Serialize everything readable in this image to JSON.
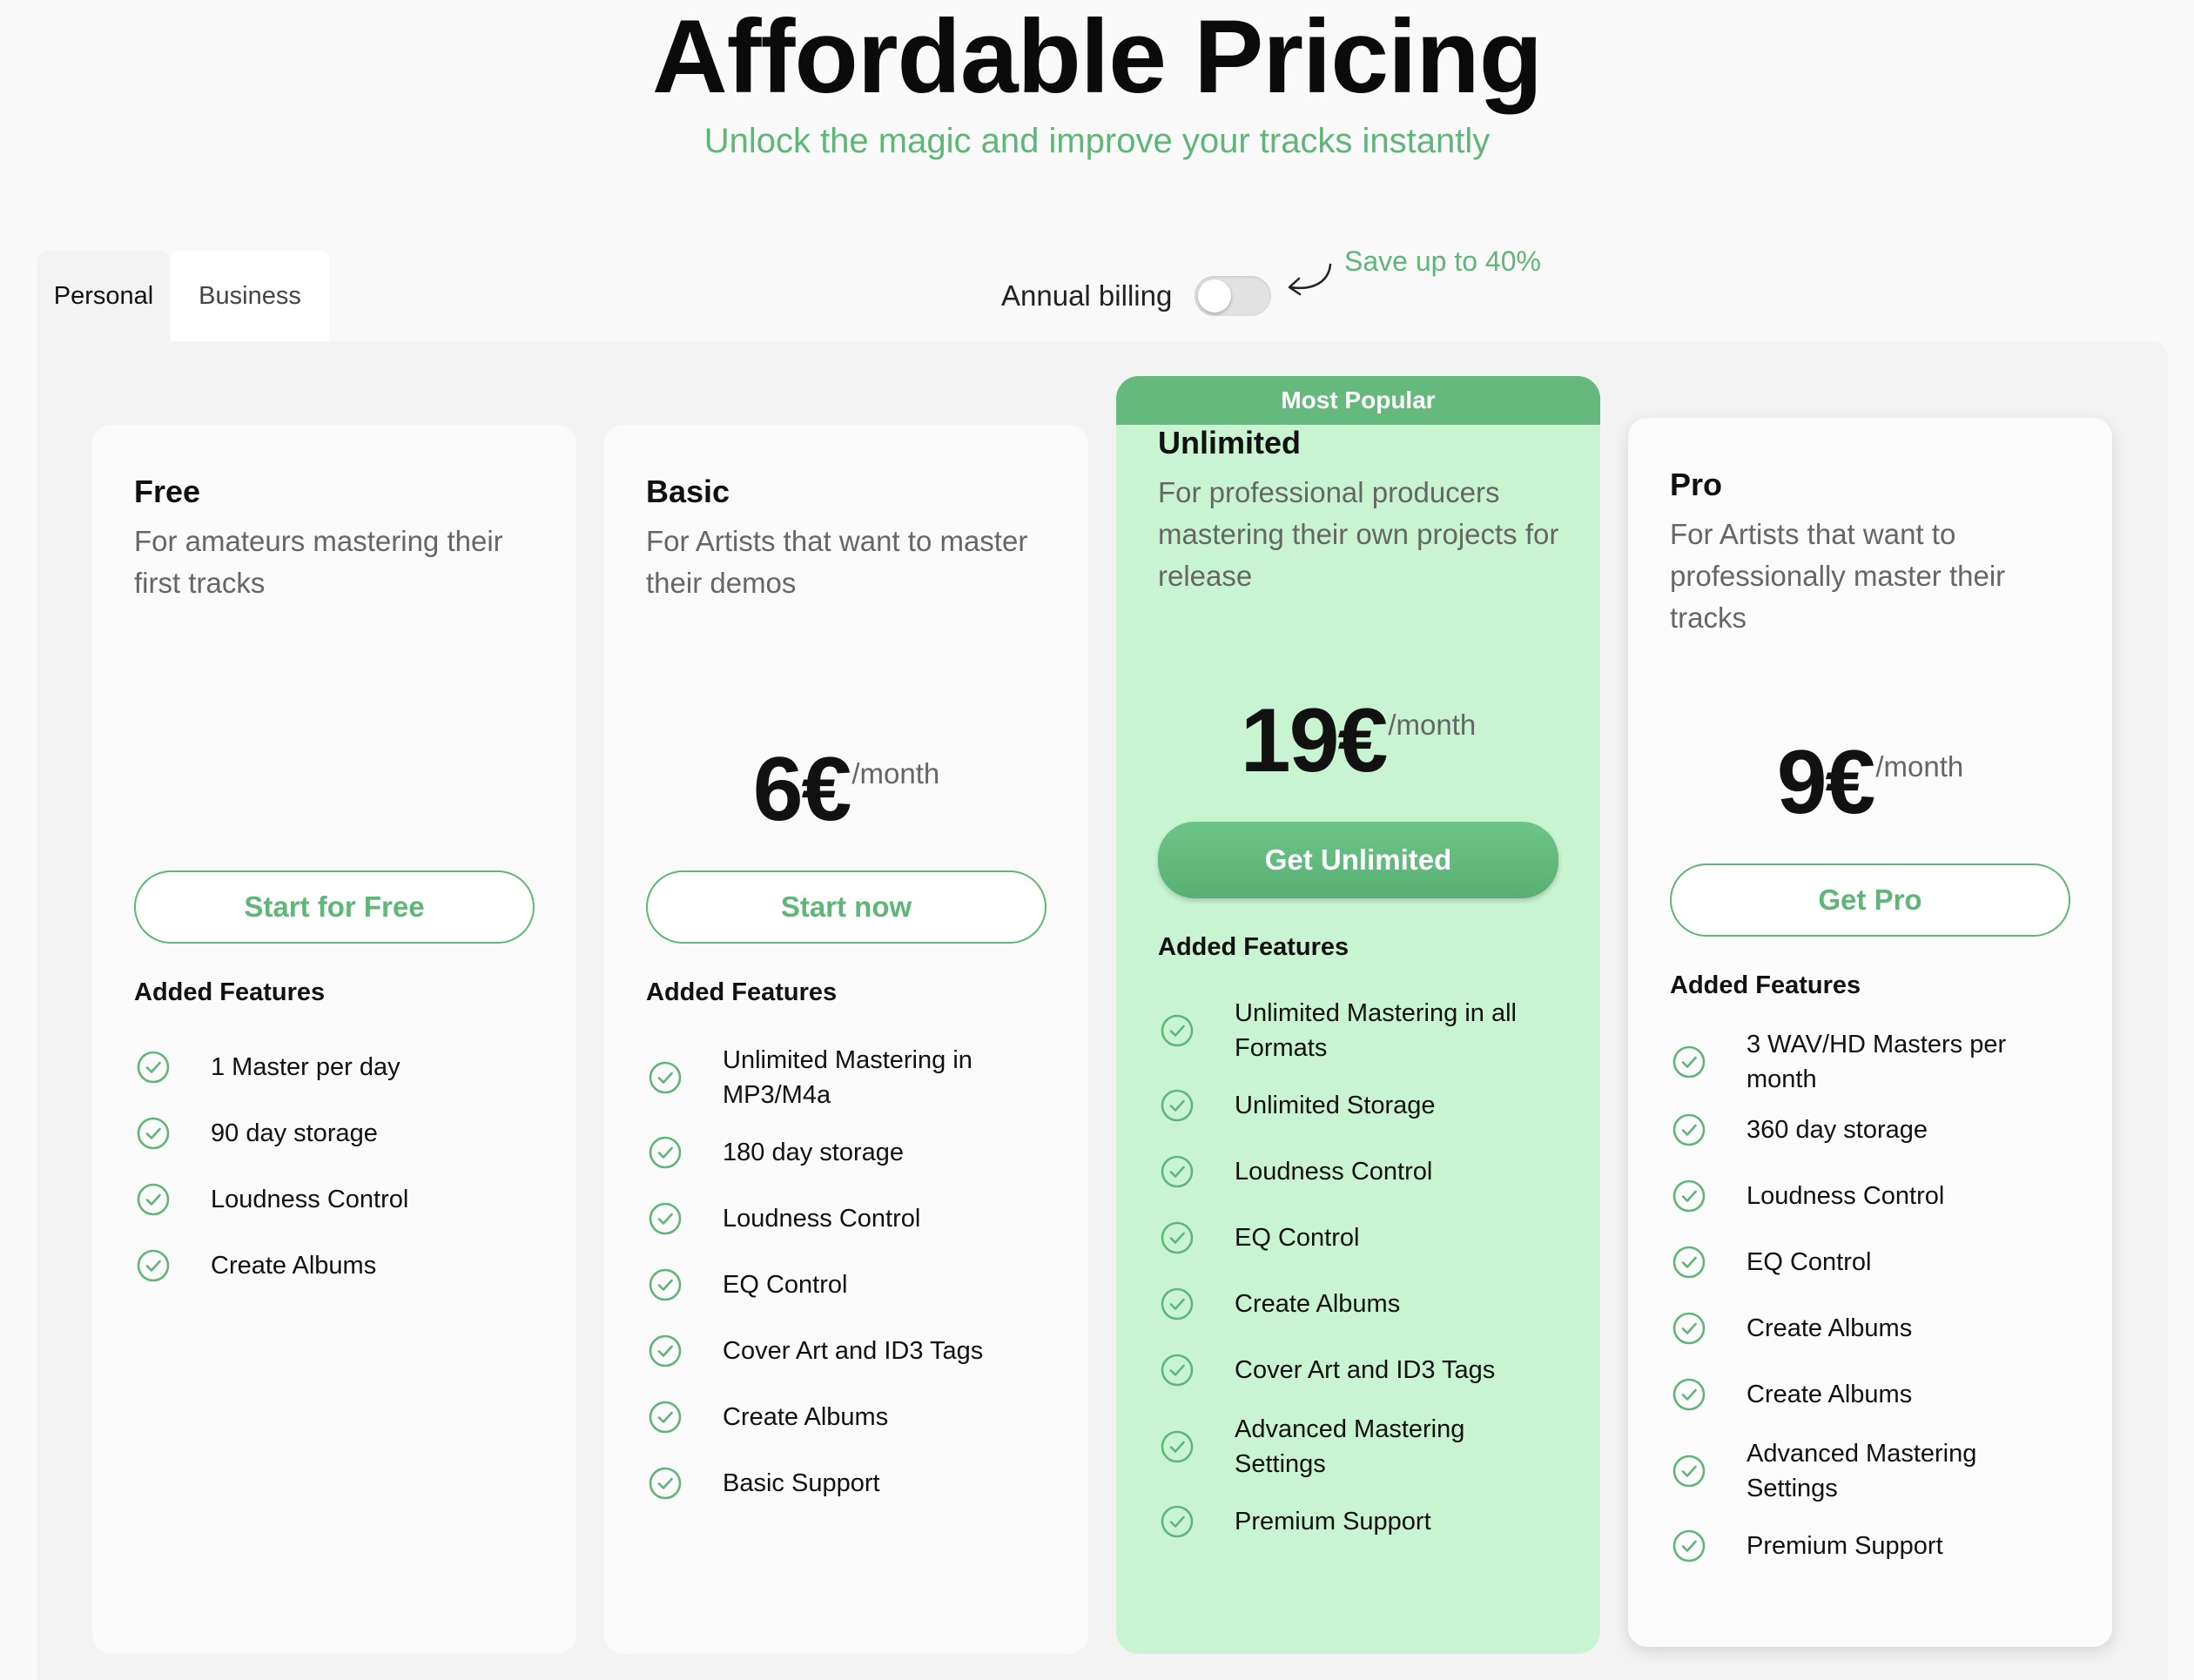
{
  "header": {
    "title": "Affordable Pricing",
    "subtitle": "Unlock the magic and improve your tracks instantly"
  },
  "tabs": [
    {
      "label": "Personal",
      "active": true
    },
    {
      "label": "Business",
      "active": false
    }
  ],
  "billing": {
    "label": "Annual billing",
    "annual_enabled": false,
    "save_note": "Save up to 40%"
  },
  "plans": [
    {
      "name": "Free",
      "description": "For amateurs mastering their first tracks",
      "price": "",
      "period": "",
      "cta": "Start for Free",
      "features_title": "Added Features",
      "features": [
        "1 Master per day",
        "90 day storage",
        "Loudness Control",
        "Create Albums"
      ]
    },
    {
      "name": "Basic",
      "description": "For Artists that want to master their demos",
      "price": "6€",
      "period": "/month",
      "cta": "Start now",
      "features_title": "Added Features",
      "features": [
        "Unlimited Mastering in MP3/M4a",
        "180 day storage",
        "Loudness Control",
        "EQ Control",
        "Cover Art and ID3 Tags",
        "Create Albums",
        "Basic Support"
      ]
    },
    {
      "badge": "Most Popular",
      "name": "Unlimited",
      "description": "For professional producers mastering their own projects for release",
      "price": "19€",
      "period": "/month",
      "cta": "Get Unlimited",
      "features_title": "Added Features",
      "features": [
        "Unlimited Mastering in all Formats",
        "Unlimited Storage",
        "Loudness Control",
        "EQ Control",
        "Create Albums",
        "Cover Art and ID3 Tags",
        "Advanced Mastering Settings",
        "Premium Support"
      ]
    },
    {
      "name": "Pro",
      "description": "For Artists that want to professionally master their tracks",
      "price": "9€",
      "period": "/month",
      "cta": "Get Pro",
      "features_title": "Added Features",
      "features": [
        "3 WAV/HD Masters per month",
        "360 day storage",
        "Loudness Control",
        "EQ Control",
        "Create Albums",
        "Create Albums",
        "Advanced Mastering Settings",
        "Premium Support"
      ]
    }
  ],
  "colors": {
    "accent": "#5fb678",
    "popular_card_bg": "#c8f4d2",
    "popular_banner_bg": "#66b97d"
  }
}
